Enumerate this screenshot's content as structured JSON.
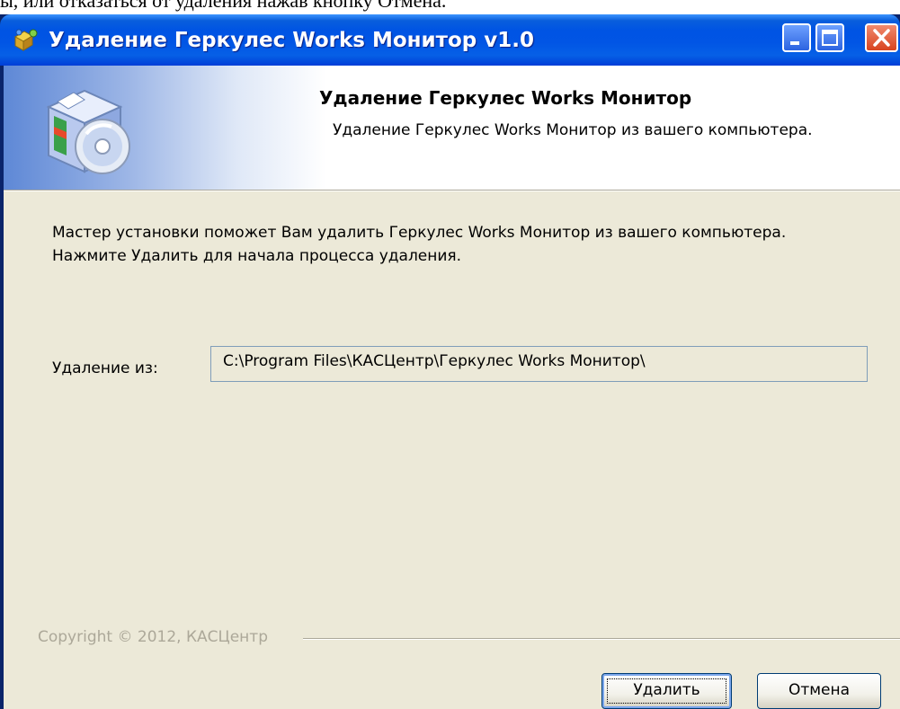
{
  "document": {
    "background_line": "ы, или отказаться от удаления нажав кнопку Отмена."
  },
  "window": {
    "title": "Удаление Геркулес Works Монитор v1.0",
    "icons": {
      "app": "setup-puzzle-icon",
      "minimize": "minimize-icon",
      "maximize": "maximize-icon",
      "close": "close-icon"
    },
    "colors": {
      "titlebar": "#0054e3",
      "client": "#ece9d8",
      "close": "#d8431f"
    }
  },
  "header": {
    "title": "Удаление Геркулес Works Монитор",
    "subtitle": "Удаление Геркулес Works Монитор из вашего компьютера.",
    "icon": "software-box-cd-icon"
  },
  "body": {
    "intro": "Мастер установки поможет Вам удалить Геркулес Works Монитор из вашего компьютера. Нажмите Удалить для начала процесса удаления.",
    "path_label": "Удаление из:",
    "path_value": "C:\\Program Files\\КАСЦентр\\Геркулес Works Монитор\\"
  },
  "footer": {
    "copyright": "Copyright © 2012, КАСЦентр",
    "remove_label": "Удалить",
    "cancel_label": "Отмена"
  }
}
